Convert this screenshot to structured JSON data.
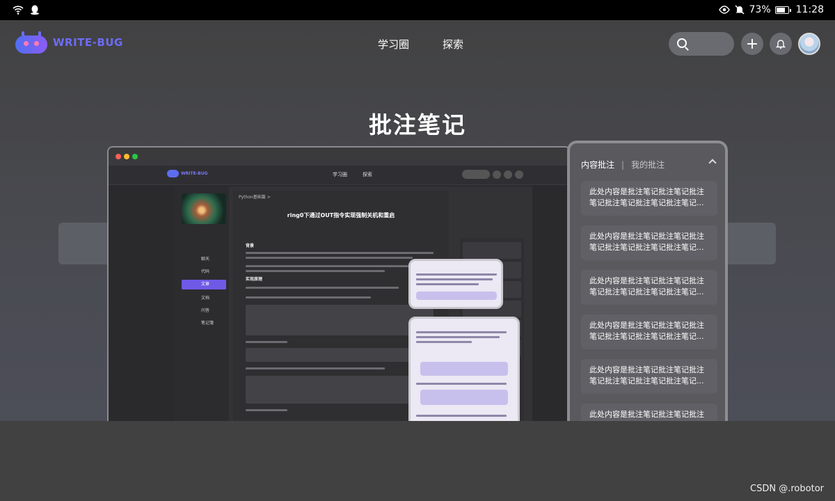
{
  "statusbar": {
    "battery": "73%",
    "time": "11:28"
  },
  "nav": {
    "brand": "WRITE-BUG",
    "links": [
      "学习圈",
      "探索"
    ]
  },
  "hero": {
    "title": "批注笔记"
  },
  "panel": {
    "tab_active": "内容批注",
    "tab_sep": "|",
    "tab_other": "我的批注",
    "notes": [
      "此处内容是批注笔记批注笔记批注笔记批注笔记批注笔记批注笔记...",
      "此处内容是批注笔记批注笔记批注笔记批注笔记批注笔记批注笔记...",
      "此处内容是批注笔记批注笔记批注笔记批注笔记批注笔记批注笔记...",
      "此处内容是批注笔记批注笔记批注笔记批注笔记批注笔记批注笔记...",
      "此处内容是批注笔记批注笔记批注笔记批注笔记批注笔记批注笔记...",
      "此处内容是批注笔记批注笔记批注笔记批注笔记批注笔记批注笔记..."
    ]
  },
  "mock": {
    "brand": "WRITE-BUG",
    "links": [
      "学习圈",
      "探索"
    ],
    "crumb": "Python基础篇 >",
    "article_title": "ring0下通过OUT指令实现强制关机和重启",
    "sections": [
      "背景",
      "实现原理"
    ],
    "side_items": [
      "聊天",
      "代码",
      "文章",
      "文档",
      "问答",
      "笔记簿"
    ]
  },
  "watermark": "CSDN @.robotor",
  "colors": {
    "accent": "#6e5ae6",
    "brand": "#6d6cf7"
  }
}
